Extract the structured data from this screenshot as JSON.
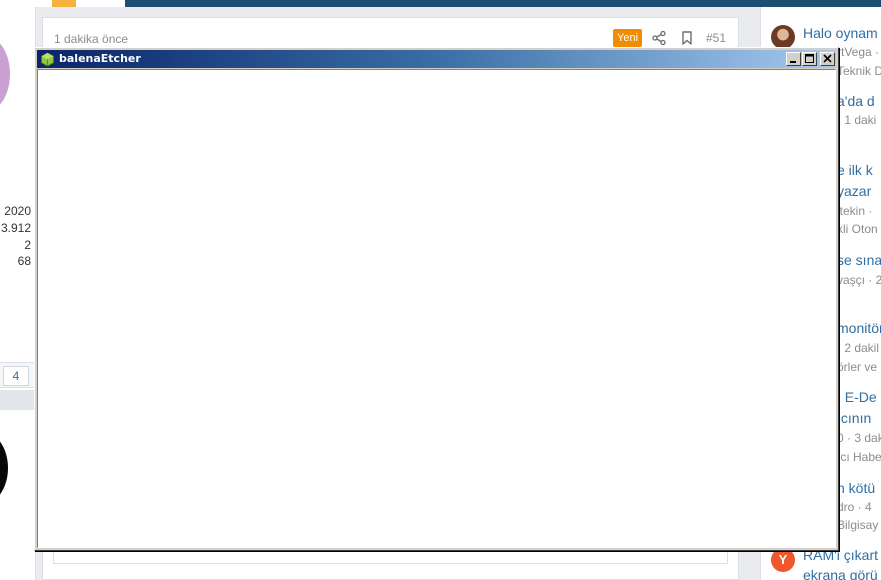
{
  "post": {
    "time": "1 dakika önce",
    "badge": "Yeni",
    "number": "#51",
    "icons": [
      "share-icon",
      "bookmark-icon"
    ]
  },
  "left_stats": {
    "joined": "2020",
    "messages": "3.912",
    "solutions": "2",
    "reactions": "68",
    "page": "4"
  },
  "sidebar": {
    "items": [
      {
        "title_lines": [
          "Halo oynam"
        ],
        "meta_lines": [
          "rtVega ·",
          "Teknik D"
        ],
        "avatar": "photo"
      },
      {
        "title_lines": [
          "a'da d"
        ],
        "meta_lines": [
          "· 1 daki"
        ]
      },
      {
        "title_lines": [
          "e ilk k",
          "yazar"
        ],
        "meta_lines": [
          "ltekin ·",
          "kli Oton"
        ]
      },
      {
        "title_lines": [
          "se sına"
        ],
        "meta_lines": [
          "vaşçı · 2"
        ]
      },
      {
        "title_lines": [
          "monitör"
        ],
        "meta_lines": [
          "· 2 dakil",
          "örler ve"
        ]
      },
      {
        "title_lines": [
          "] E-De",
          "ıcının"
        ],
        "meta_lines": [
          "0 · 3 dak",
          "ıcı Habe"
        ]
      },
      {
        "title_lines": [
          "n kötü"
        ],
        "meta_lines": [
          "dro · 4",
          "Bilgisay"
        ]
      },
      {
        "title_lines": [
          "RAM'i çıkart",
          "ekrana görü"
        ],
        "meta_lines": [],
        "avatar_letter": "Y"
      }
    ]
  },
  "window": {
    "title": "balenaEtcher",
    "controls": [
      "minimize-icon",
      "maximize-icon",
      "close-icon"
    ]
  },
  "colors": {
    "accent_link": "#2f6fa3",
    "badge_orange": "#f28c00",
    "titlebar_start": "#0a246a",
    "titlebar_end": "#a6caf0"
  }
}
